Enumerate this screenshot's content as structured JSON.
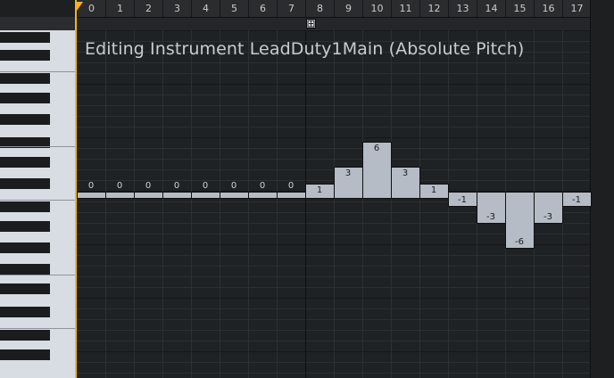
{
  "editor": {
    "title": "Editing Instrument LeadDuty1Main (Absolute Pitch)"
  },
  "ruler": {
    "ticks": [
      "0",
      "1",
      "2",
      "3",
      "4",
      "5",
      "6",
      "7",
      "8",
      "9",
      "10",
      "11",
      "12",
      "13",
      "14",
      "15",
      "16",
      "17"
    ]
  },
  "loop_marker": {
    "position": 8
  },
  "sequence": {
    "values": [
      0,
      0,
      0,
      0,
      0,
      0,
      0,
      0,
      1,
      3,
      6,
      3,
      1,
      -1,
      -3,
      -6,
      -3,
      -1
    ],
    "labels": [
      "0",
      "0",
      "0",
      "0",
      "0",
      "0",
      "0",
      "0",
      "1",
      "3",
      "6",
      "3",
      "1",
      "-1",
      "-3",
      "-6",
      "-3",
      "-1"
    ]
  },
  "colors": {
    "background": "#1f2225",
    "bar_fill": "#b6bcc5",
    "playhead": "#f5b418"
  }
}
